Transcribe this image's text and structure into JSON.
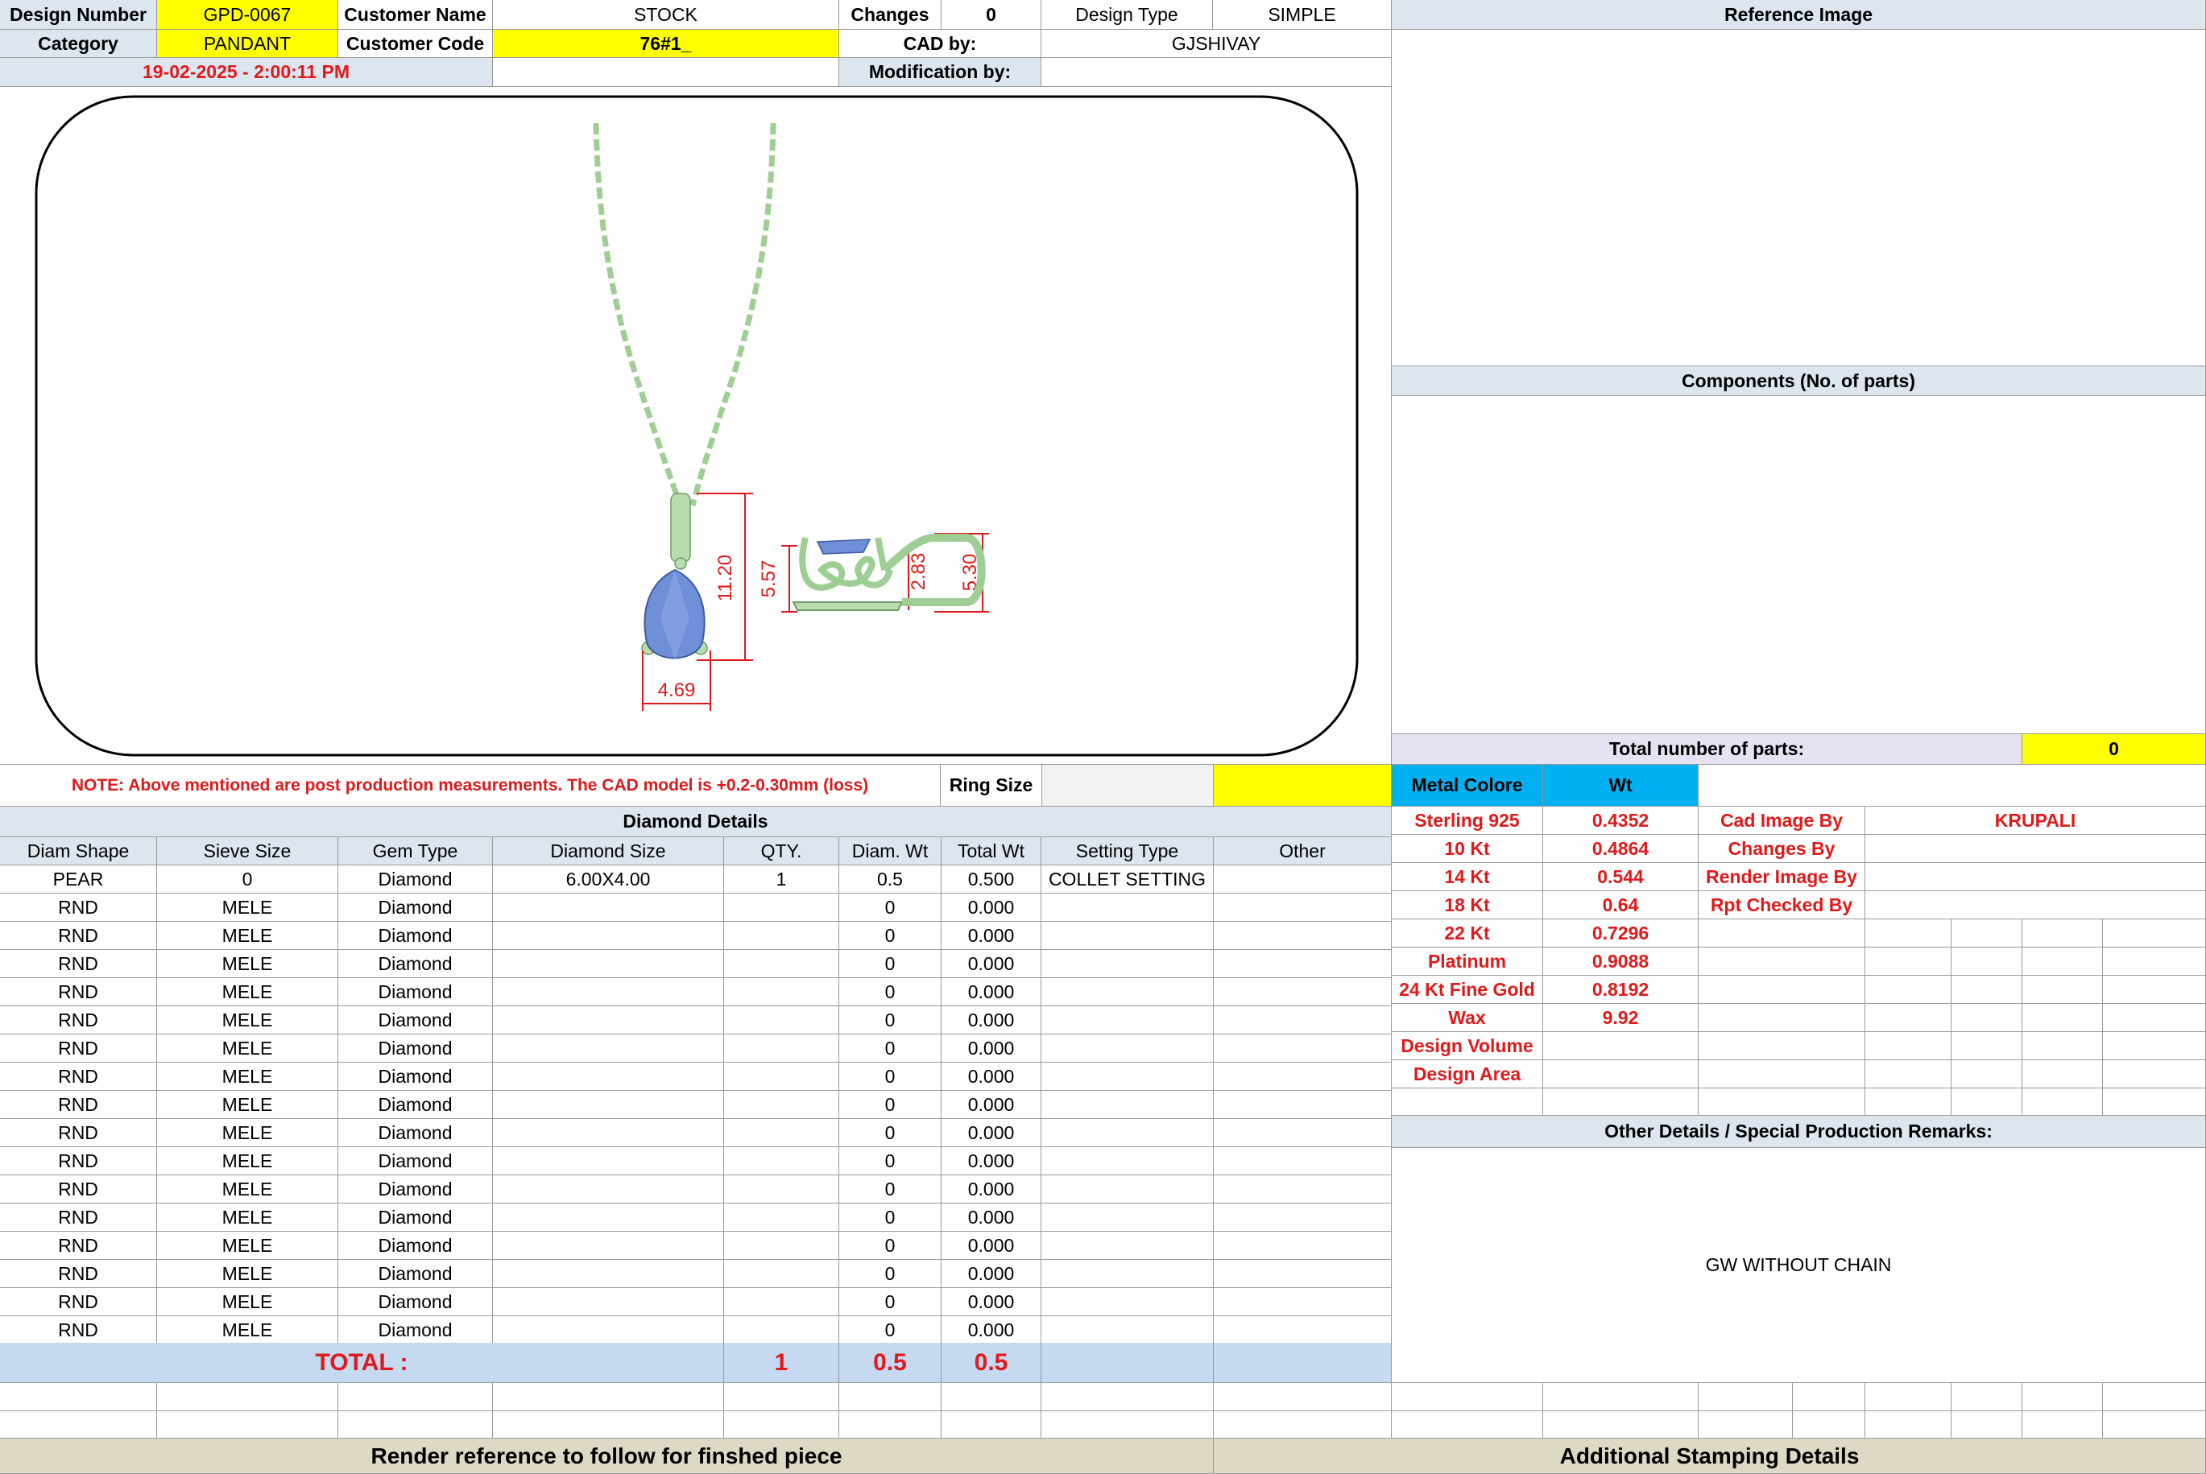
{
  "header": {
    "design_number_label": "Design Number",
    "design_number": "GPD-0067",
    "customer_name_label": "Customer Name",
    "customer_name": "STOCK",
    "changes_label": "Changes",
    "changes": "0",
    "design_type_label": "Design Type",
    "design_type": "SIMPLE",
    "category_label": "Category",
    "category": "PANDANT",
    "customer_code_label": "Customer Code",
    "customer_code": "76#1_",
    "cad_by_label": "CAD by:",
    "cad_by": "GJSHIVAY",
    "timestamp": "19-02-2025 - 2:00:11 PM",
    "modification_by_label": "Modification by:",
    "modification_by": ""
  },
  "image": {
    "dim_width": "4.69",
    "dim_height_total": "11.20",
    "dim_height_drop": "5.57",
    "dim_side_small": "2.83",
    "dim_side_height": "5.30"
  },
  "right_panel": {
    "reference_image_label": "Reference Image",
    "components_label": "Components (No. of parts)",
    "total_parts_label": "Total number of parts:",
    "total_parts": "0"
  },
  "note": "NOTE: Above mentioned are post production measurements. The CAD model is +0.2-0.30mm (loss)",
  "ring_size_label": "Ring Size",
  "ring_size": "",
  "metal": {
    "header_label": "Metal Colore",
    "wt_label": "Wt",
    "rows": [
      {
        "name": "Sterling 925",
        "wt": "0.4352",
        "k": "Cad Image By",
        "v": "KRUPALI"
      },
      {
        "name": "10 Kt",
        "wt": "0.4864",
        "k": "Changes By",
        "v": ""
      },
      {
        "name": "14 Kt",
        "wt": "0.544",
        "k": "Render Image By",
        "v": ""
      },
      {
        "name": "18 Kt",
        "wt": "0.64",
        "k": "Rpt Checked By",
        "v": ""
      },
      {
        "name": "22 Kt",
        "wt": "0.7296",
        "k": "",
        "v": ""
      },
      {
        "name": "Platinum",
        "wt": "0.9088",
        "k": "",
        "v": ""
      },
      {
        "name": "24 Kt Fine Gold",
        "wt": "0.8192",
        "k": "",
        "v": ""
      },
      {
        "name": "Wax",
        "wt": "9.92",
        "k": "",
        "v": ""
      },
      {
        "name": "Design Volume",
        "wt": "",
        "k": "",
        "v": ""
      },
      {
        "name": "Design Area",
        "wt": "",
        "k": "",
        "v": ""
      }
    ]
  },
  "other_details_label": "Other Details / Special Production Remarks:",
  "other_details_text": "GW WITHOUT CHAIN",
  "diamond": {
    "title": "Diamond Details",
    "columns": [
      "Diam Shape",
      "Sieve Size",
      "Gem Type",
      "Diamond Size",
      "QTY.",
      "Diam. Wt",
      "Total Wt",
      "Setting Type",
      "Other"
    ],
    "rows": [
      [
        "PEAR",
        "0",
        "Diamond",
        "6.00X4.00",
        "1",
        "0.5",
        "0.500",
        "COLLET SETTING",
        ""
      ],
      [
        "RND",
        "MELE",
        "Diamond",
        "",
        "",
        "0",
        "0.000",
        "",
        ""
      ],
      [
        "RND",
        "MELE",
        "Diamond",
        "",
        "",
        "0",
        "0.000",
        "",
        ""
      ],
      [
        "RND",
        "MELE",
        "Diamond",
        "",
        "",
        "0",
        "0.000",
        "",
        ""
      ],
      [
        "RND",
        "MELE",
        "Diamond",
        "",
        "",
        "0",
        "0.000",
        "",
        ""
      ],
      [
        "RND",
        "MELE",
        "Diamond",
        "",
        "",
        "0",
        "0.000",
        "",
        ""
      ],
      [
        "RND",
        "MELE",
        "Diamond",
        "",
        "",
        "0",
        "0.000",
        "",
        ""
      ],
      [
        "RND",
        "MELE",
        "Diamond",
        "",
        "",
        "0",
        "0.000",
        "",
        ""
      ],
      [
        "RND",
        "MELE",
        "Diamond",
        "",
        "",
        "0",
        "0.000",
        "",
        ""
      ],
      [
        "RND",
        "MELE",
        "Diamond",
        "",
        "",
        "0",
        "0.000",
        "",
        ""
      ],
      [
        "RND",
        "MELE",
        "Diamond",
        "",
        "",
        "0",
        "0.000",
        "",
        ""
      ],
      [
        "RND",
        "MELE",
        "Diamond",
        "",
        "",
        "0",
        "0.000",
        "",
        ""
      ],
      [
        "RND",
        "MELE",
        "Diamond",
        "",
        "",
        "0",
        "0.000",
        "",
        ""
      ],
      [
        "RND",
        "MELE",
        "Diamond",
        "",
        "",
        "0",
        "0.000",
        "",
        ""
      ],
      [
        "RND",
        "MELE",
        "Diamond",
        "",
        "",
        "0",
        "0.000",
        "",
        ""
      ],
      [
        "RND",
        "MELE",
        "Diamond",
        "",
        "",
        "0",
        "0.000",
        "",
        ""
      ],
      [
        "RND",
        "MELE",
        "Diamond",
        "",
        "",
        "0",
        "0.000",
        "",
        ""
      ]
    ],
    "total_label": "TOTAL :",
    "total_qty": "1",
    "total_diam_wt": "0.5",
    "total_wt": "0.5"
  },
  "footer": {
    "render_ref_label": "Render reference to follow for finshed piece",
    "stamping_label": "Additional Stamping Details"
  },
  "colors": {
    "header_blue": "#dde5ef",
    "highlight_yellow": "#ffff00",
    "accent_red": "#e0191a",
    "metal_cyan": "#00b0f0",
    "total_blue": "#c5d9f1",
    "footer_tan": "#ddd9c4",
    "metal_green": "#b9dcae",
    "stone_blue": "#6f8fd8"
  }
}
